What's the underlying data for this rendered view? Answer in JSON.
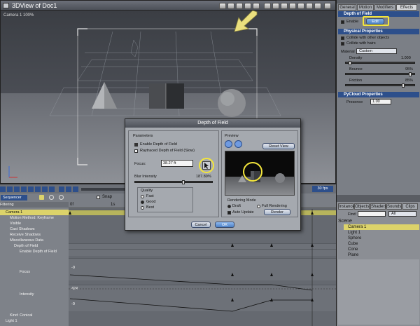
{
  "viewport": {
    "title": "3DView of Doc1",
    "camera_label": "Camera 1 100%"
  },
  "right_panel": {
    "tabs": [
      "General",
      "Motion",
      "Modifiers",
      "Effects"
    ],
    "dof_header": "Depth of Field",
    "enable_label": "Enable",
    "edit_button": "Edit",
    "physical_header": "Physical Properties",
    "collide_objects": "Collide with other objects",
    "collide_hairs": "Collide with hairs",
    "material_label": "Material",
    "material_value": "Custom",
    "density_label": "Density",
    "density_value": "1.000",
    "bounce_label": "Bounce",
    "bounce_value": "95%",
    "friction_label": "Friction",
    "friction_value": "85%",
    "pycloud_header": "PyCloud Properties",
    "presence_label": "Presence",
    "presence_value": "1.00"
  },
  "scene_panel": {
    "tabs": [
      "Instances",
      "Objects",
      "Shaders",
      "Sounds",
      "Clips"
    ],
    "find_label": "Find:",
    "find_filter": "All",
    "scene_label": "Scene",
    "items": [
      "Camera 1",
      "Light 1",
      "Sphere",
      "Cube",
      "Cone",
      "Plane"
    ],
    "selected": "Camera 1"
  },
  "timeline": {
    "sequencer_label": "Sequencer",
    "snap_label": "Snap",
    "fps_label": "30 fps",
    "filtering_label": "Filtering",
    "tree": [
      "Camera 1",
      "Motion Method: Keyframe",
      "Visible",
      "Cast Shadows",
      "Receive Shadows",
      "Miscellaneous Data",
      "Depth of Field",
      "Enable Depth of Field",
      "Focus",
      "Intensity",
      "Kind: Conical",
      "Light 1"
    ],
    "ruler_start": "0f",
    "ruler_mark": "1s",
    "track_values": [
      "-0",
      "424",
      "-0"
    ]
  },
  "dialog": {
    "title": "Depth of Field",
    "parameters_label": "Parameters",
    "enable_dof": "Enable Depth of Field",
    "raytraced_dof": "Raytraced Depth of Field (Slow)",
    "focus_label": "Focus:",
    "focus_value": "38.27 ft",
    "blur_label": "Blur Intensity",
    "blur_value": "187.89%",
    "blur_fraction": 0.62,
    "quality_label": "Quality",
    "quality_options": [
      "Fast",
      "Good",
      "Best"
    ],
    "preview_label": "Preview",
    "reset_view": "Reset View",
    "rendering_mode_label": "Rendering Mode",
    "draft": "Draft",
    "full_rendering": "Full Rendering",
    "auto_update": "Auto Update",
    "render_button": "Render",
    "cancel_button": "Cancel",
    "ok_button": "OK"
  },
  "colors": {
    "highlight": "#f3e53b",
    "section_header": "#2d4f8b",
    "selection": "#dcd36a"
  }
}
